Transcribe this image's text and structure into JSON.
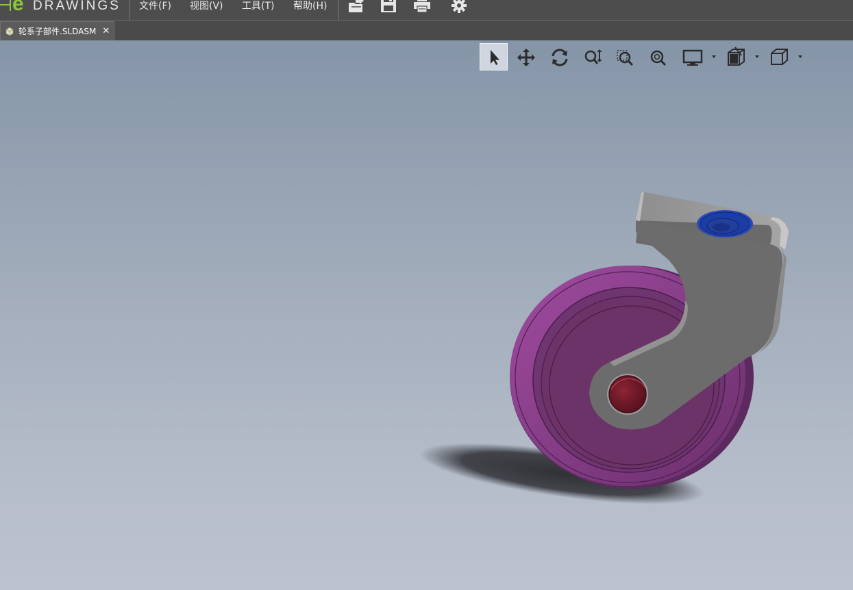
{
  "app": {
    "logo_text": "DRAWINGS",
    "logo_letter": "e"
  },
  "menu": {
    "items": [
      "文件(F)",
      "视图(V)",
      "工具(T)",
      "帮助(H)"
    ]
  },
  "toolbar": {
    "icons": [
      "open-icon",
      "save-icon",
      "print-icon",
      "settings-gear-icon"
    ]
  },
  "tab": {
    "label": "轮系子部件.SLDASM",
    "close": "✕",
    "icon": "assembly-icon"
  },
  "view_toolbar": {
    "tools": [
      {
        "name": "select-tool",
        "active": true
      },
      {
        "name": "pan-tool"
      },
      {
        "name": "rotate-tool"
      },
      {
        "name": "zoom-tool"
      },
      {
        "name": "zoom-to-area-tool"
      },
      {
        "name": "zoom-to-fit-tool"
      },
      {
        "name": "display-style-tool",
        "dropdown": true
      },
      {
        "name": "section-view-tool",
        "dropdown": true
      },
      {
        "name": "standard-views-tool",
        "dropdown": true
      }
    ]
  },
  "colors": {
    "menubar": "#4d4d4d",
    "logo_green": "#8cc63f",
    "wheel_purple": "#6e3570",
    "bracket_gray": "#6c6c6c",
    "axle_red": "#7a1a2a",
    "bearing_blue": "#1b3ea6"
  }
}
